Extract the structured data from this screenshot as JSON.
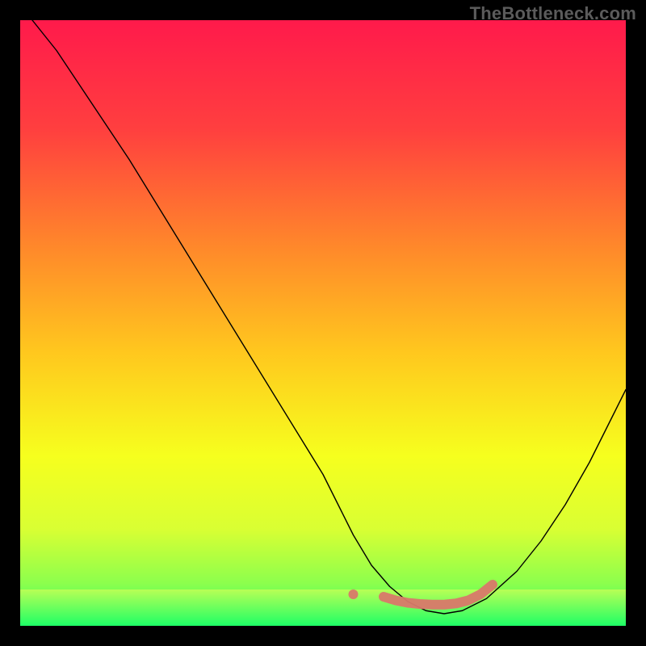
{
  "watermark": "TheBottleneck.com",
  "chart_data": {
    "type": "line",
    "title": "",
    "xlabel": "",
    "ylabel": "",
    "xlim": [
      0,
      100
    ],
    "ylim": [
      0,
      100
    ],
    "grid": false,
    "series": [
      {
        "name": "bottleneck-curve",
        "color": "#000000",
        "width": 1.4,
        "x": [
          2,
          6,
          10,
          14,
          18,
          22,
          26,
          30,
          34,
          38,
          42,
          46,
          50,
          53,
          55,
          58,
          61,
          64,
          67,
          70,
          73,
          77,
          82,
          86,
          90,
          94,
          98,
          100
        ],
        "y": [
          100,
          95,
          89,
          83,
          77,
          70.5,
          64,
          57.5,
          51,
          44.5,
          38,
          31.5,
          25,
          19,
          15,
          10,
          6.5,
          4,
          2.5,
          2,
          2.5,
          4.5,
          9,
          14,
          20,
          27,
          35,
          39
        ]
      }
    ],
    "highlight": {
      "color": "#d9786a",
      "dot": {
        "x": 55,
        "y": 5.2,
        "r": 6
      },
      "stroke_width": 12,
      "x": [
        60,
        62,
        64,
        66,
        68,
        70,
        72,
        74,
        76,
        78
      ],
      "y": [
        4.8,
        4.2,
        3.8,
        3.6,
        3.5,
        3.5,
        3.7,
        4.2,
        5.2,
        6.8
      ]
    },
    "background_gradient": {
      "stops": [
        {
          "offset": 0.0,
          "color": "#ff1a4b"
        },
        {
          "offset": 0.18,
          "color": "#ff3f3f"
        },
        {
          "offset": 0.38,
          "color": "#ff8a2a"
        },
        {
          "offset": 0.55,
          "color": "#ffc81e"
        },
        {
          "offset": 0.72,
          "color": "#f6ff1e"
        },
        {
          "offset": 0.84,
          "color": "#d9ff33"
        },
        {
          "offset": 0.93,
          "color": "#8cff4d"
        },
        {
          "offset": 1.0,
          "color": "#1eff66"
        }
      ]
    },
    "green_band": {
      "y0": 0,
      "y1": 6,
      "color_top": "#b8ff55",
      "color_bottom": "#1eff66"
    }
  }
}
